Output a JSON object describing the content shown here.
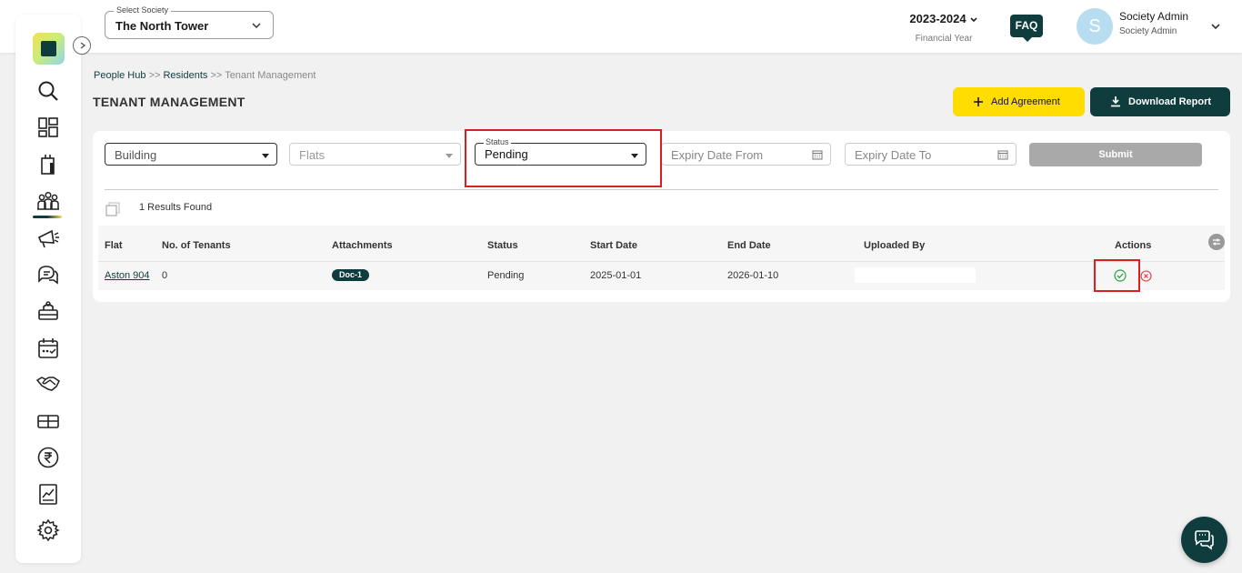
{
  "header": {
    "society_label": "Select Society",
    "society_value": "The North Tower",
    "financial_year": "2023-2024",
    "financial_year_label": "Financial Year",
    "faq_label": "FAQ",
    "avatar_initial": "S",
    "user_name": "Society Admin",
    "user_role": "Society Admin"
  },
  "sidebar": {
    "icons": [
      "search-icon",
      "dashboard-icon",
      "tower-icon",
      "people-hub-icon",
      "announcement-icon",
      "chat-icon",
      "facility-icon",
      "calendar-icon",
      "handshake-icon",
      "inventory-icon",
      "rupee-icon",
      "report-icon",
      "settings-icon"
    ],
    "active": "people-hub-icon"
  },
  "breadcrumb": {
    "item1": "People Hub",
    "sep1": ">>",
    "item2": "Residents",
    "sep2": ">>",
    "current": "Tenant Management"
  },
  "page": {
    "title": "TENANT MANAGEMENT",
    "add_agreement_label": "Add Agreement",
    "download_report_label": "Download Report"
  },
  "filters": {
    "building_placeholder": "Building",
    "flats_placeholder": "Flats",
    "status_label": "Status",
    "status_value": "Pending",
    "expiry_from_placeholder": "Expiry Date From",
    "expiry_to_placeholder": "Expiry Date To",
    "submit_label": "Submit"
  },
  "results": {
    "count_text": "1 Results Found"
  },
  "table": {
    "headers": [
      "Flat",
      "No. of Tenants",
      "Attachments",
      "Status",
      "Start Date",
      "End Date",
      "Uploaded By",
      "Actions"
    ],
    "rows": [
      {
        "flat": "Aston 904",
        "tenants": "0",
        "attachment": "Doc-1",
        "status": "Pending",
        "start_date": "2025-01-01",
        "end_date": "2026-01-10"
      }
    ]
  },
  "colors": {
    "brand_dark": "#0f3d3e",
    "accent_yellow": "#ffdd00",
    "approve_green": "#2ea043",
    "reject_red": "#e0393e",
    "highlight_red": "#d92020"
  }
}
